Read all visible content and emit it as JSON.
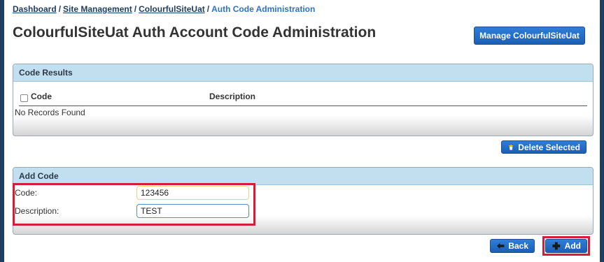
{
  "breadcrumb": {
    "items": [
      "Dashboard",
      "Site Management",
      "ColourfulSiteUat"
    ],
    "separator": "/",
    "current": "Auth Code Administration"
  },
  "page": {
    "title": "ColourfulSiteUat Auth Account Code Administration"
  },
  "buttons": {
    "manage": "Manage ColourfulSiteUat",
    "delete_selected": "Delete Selected",
    "back": "Back",
    "add": "Add"
  },
  "code_results": {
    "header": "Code Results",
    "columns": [
      "Code",
      "Description"
    ],
    "empty_message": "No Records Found"
  },
  "add_code": {
    "header": "Add Code",
    "code_label": "Code:",
    "code_value": "123456",
    "description_label": "Description:",
    "description_value": "TEST"
  },
  "colors": {
    "frame": "#1f3e63",
    "button": "#2f7ed8",
    "panel_header": "#c2dff0",
    "highlight": "#d21e3a"
  },
  "icons": {
    "delete": "trash-icon",
    "back": "arrow-left-icon",
    "add": "plus-icon"
  }
}
